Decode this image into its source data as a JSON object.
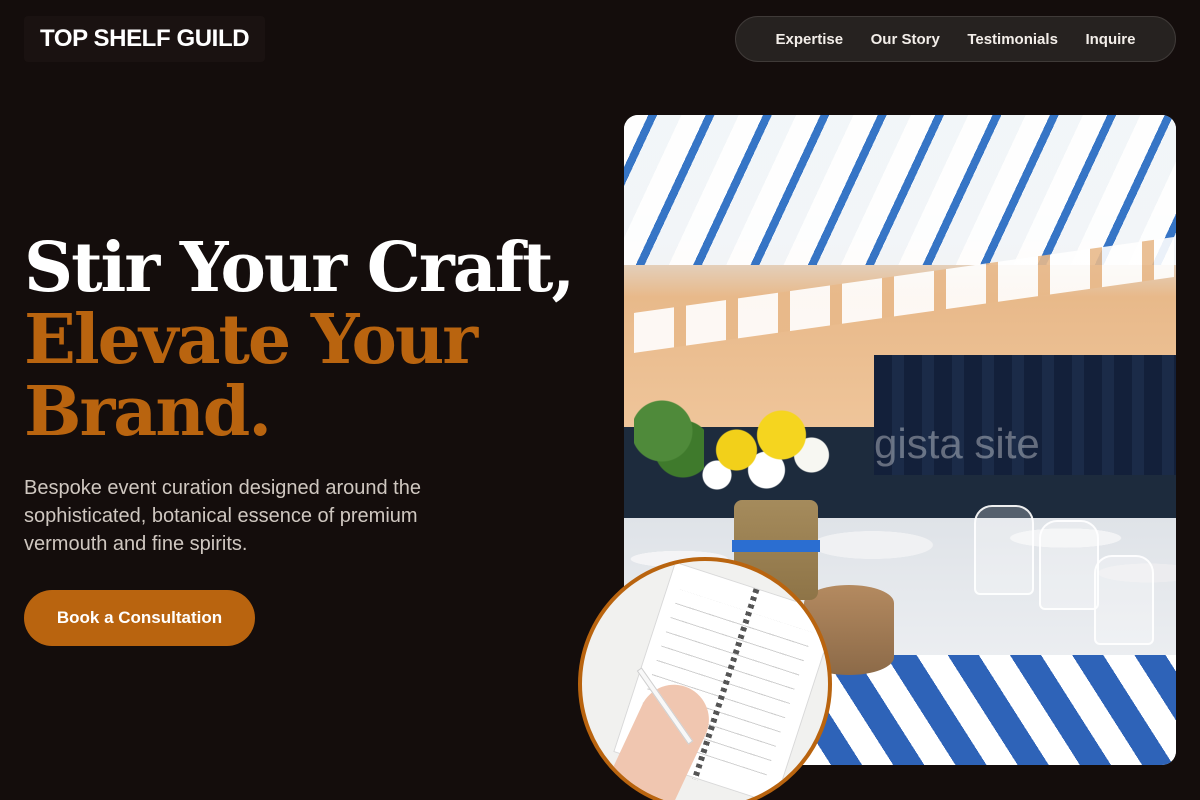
{
  "header": {
    "brand": "TOP SHELF GUILD",
    "nav": [
      "Expertise",
      "Our Story",
      "Testimonials",
      "Inquire"
    ]
  },
  "hero": {
    "headline_line1": "Stir Your Craft,",
    "headline_line2": "Elevate Your",
    "headline_line3": "Brand.",
    "subcopy": "Bespoke event curation designed around the sophisticated, botanical essence of premium vermouth and fine spirits.",
    "cta": "Book a Consultation",
    "image_watermark": "gista site"
  },
  "colors": {
    "background": "#140d0c",
    "accent": "#b9640f",
    "nav_background": "#262220",
    "text_light": "#ffffff"
  }
}
